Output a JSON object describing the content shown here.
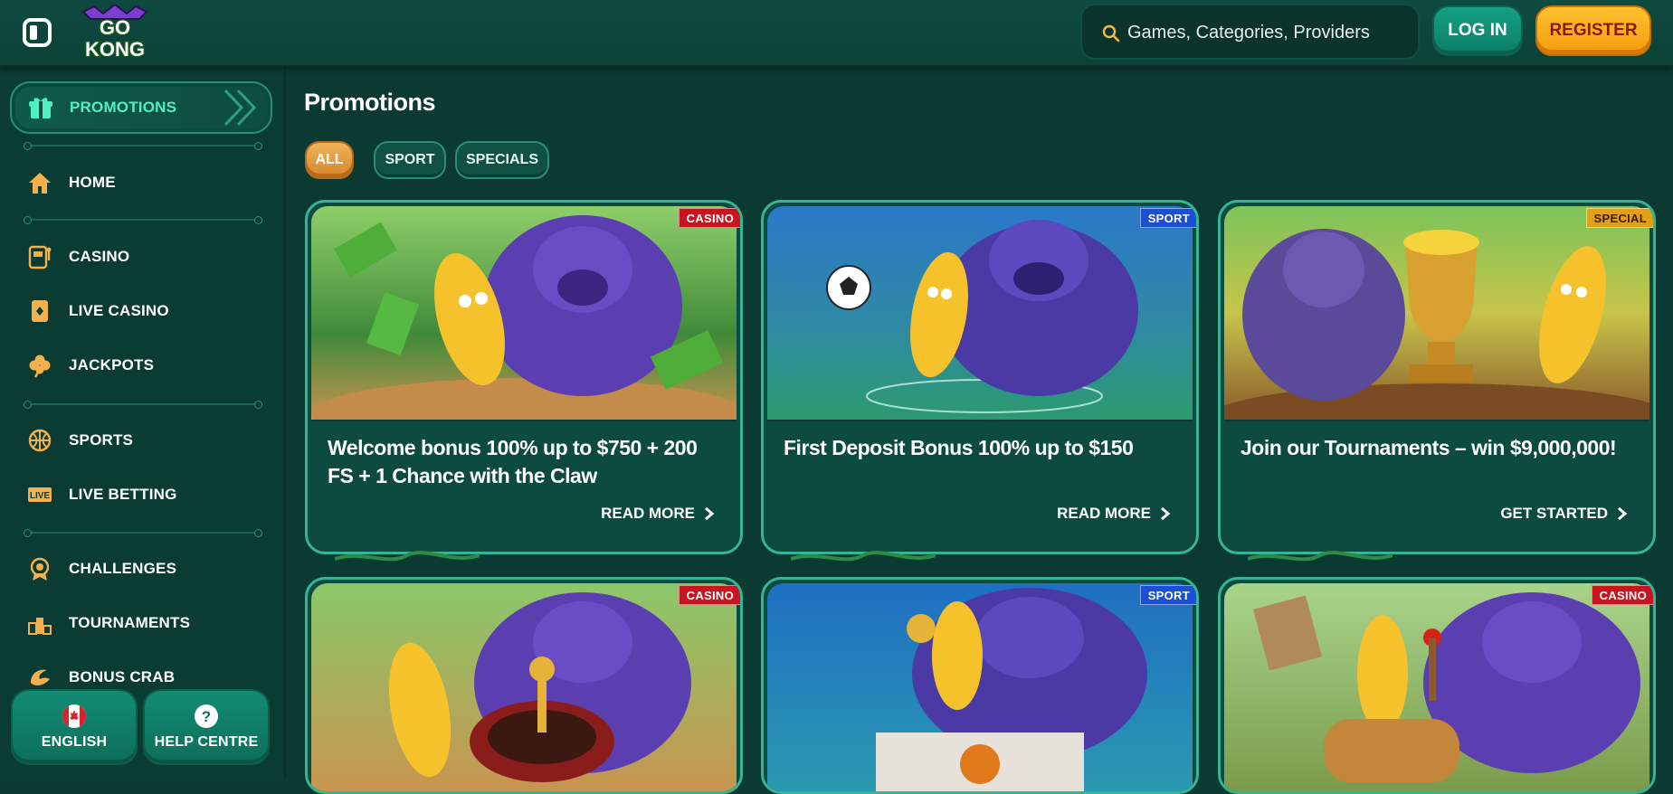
{
  "header": {
    "logo_text": "GO KONG",
    "search_placeholder": "Games, Categories, Providers",
    "login_label": "LOG IN",
    "register_label": "REGISTER"
  },
  "sidebar": {
    "items": [
      {
        "label": "PROMOTIONS",
        "icon": "gift-icon"
      },
      {
        "label": "HOME",
        "icon": "home-icon"
      },
      {
        "label": "CASINO",
        "icon": "slot-machine-icon"
      },
      {
        "label": "LIVE CASINO",
        "icon": "card-icon"
      },
      {
        "label": "JACKPOTS",
        "icon": "clover-icon"
      },
      {
        "label": "SPORTS",
        "icon": "basketball-icon"
      },
      {
        "label": "LIVE BETTING",
        "icon": "live-icon"
      },
      {
        "label": "CHALLENGES",
        "icon": "badge-icon"
      },
      {
        "label": "TOURNAMENTS",
        "icon": "podium-icon"
      },
      {
        "label": "BONUS CRAB",
        "icon": "claw-icon"
      }
    ],
    "language_label": "ENGLISH",
    "help_label": "HELP CENTRE"
  },
  "main": {
    "title": "Promotions",
    "filters": [
      "ALL",
      "SPORT",
      "SPECIALS"
    ],
    "cards": [
      {
        "tag": "CASINO",
        "title": "Welcome bonus 100% up to $750 + 200 FS + 1 Chance with the Claw",
        "cta": "READ MORE"
      },
      {
        "tag": "SPORT",
        "title": "First Deposit Bonus 100% up to $150",
        "cta": "READ MORE"
      },
      {
        "tag": "SPECIAL",
        "title": "Join our Tournaments – win $9,000,000!",
        "cta": "GET STARTED"
      },
      {
        "tag": "CASINO"
      },
      {
        "tag": "SPORT"
      },
      {
        "tag": "CASINO"
      }
    ]
  },
  "colors": {
    "background": "#0b3a32",
    "accent_teal": "#36b596",
    "promo_active": "#4ff0c2",
    "register_yellow": "#ffc230",
    "tag_casino": "#c8141e",
    "tag_sport": "#1a4fd6",
    "tag_special": "#e2a014"
  }
}
